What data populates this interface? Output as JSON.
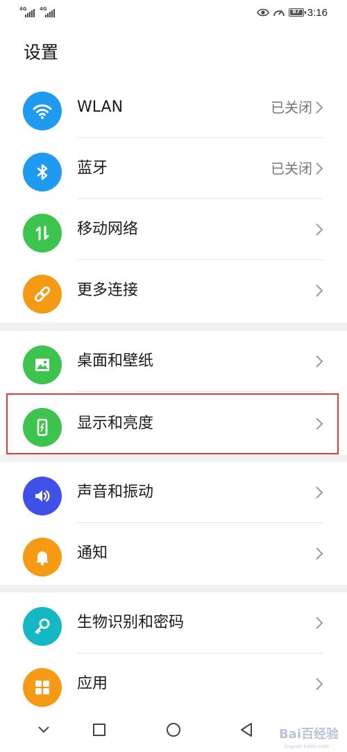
{
  "status_bar": {
    "sim1": "4G",
    "sim2": "4G",
    "battery": "87",
    "time": "3:16"
  },
  "page_title": "设置",
  "rows": [
    {
      "label": "WLAN",
      "value": "已关闭",
      "icon": "wifi-icon",
      "color": "#1E9BF0"
    },
    {
      "label": "蓝牙",
      "value": "已关闭",
      "icon": "bluetooth-icon",
      "color": "#1E9BF0"
    },
    {
      "label": "移动网络",
      "value": "",
      "icon": "mobile-data-icon",
      "color": "#3CC44E"
    },
    {
      "label": "更多连接",
      "value": "",
      "icon": "link-icon",
      "color": "#F59A14"
    },
    {
      "label": "桌面和壁纸",
      "value": "",
      "icon": "image-icon",
      "color": "#3CC44E"
    },
    {
      "label": "显示和亮度",
      "value": "",
      "icon": "display-icon",
      "color": "#3CC44E"
    },
    {
      "label": "声音和振动",
      "value": "",
      "icon": "speaker-icon",
      "color": "#3F51E6"
    },
    {
      "label": "通知",
      "value": "",
      "icon": "bell-icon",
      "color": "#F59A14"
    },
    {
      "label": "生物识别和密码",
      "value": "",
      "icon": "key-icon",
      "color": "#14B8C4"
    },
    {
      "label": "应用",
      "value": "",
      "icon": "apps-icon",
      "color": "#F59A14"
    }
  ],
  "watermark": {
    "text": "Bai百经验",
    "sub": "jingyan.baidu.com"
  }
}
